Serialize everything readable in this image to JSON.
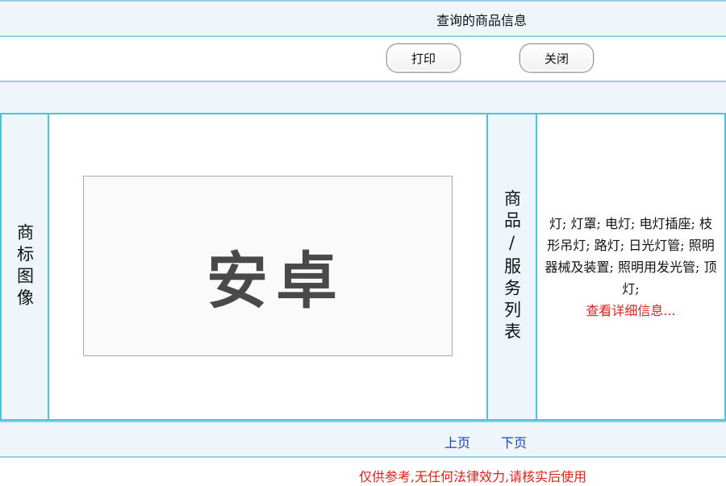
{
  "header": {
    "title": "查询的商品信息"
  },
  "toolbar": {
    "print_label": "打印",
    "close_label": "关闭"
  },
  "main": {
    "image_label": "商标图像",
    "trademark_text": "安卓",
    "goods_label": "商品/服务列表",
    "goods_list": "灯; 灯罩; 电灯; 电灯插座; 枝形吊灯; 路灯; 日光灯管; 照明器械及装置; 照明用发光管; 顶灯;",
    "details_link": "查看详细信息..."
  },
  "pager": {
    "prev": "上页",
    "next": "下页"
  },
  "footer": {
    "note": "仅供参考,无任何法律效力,请核实后使用"
  }
}
